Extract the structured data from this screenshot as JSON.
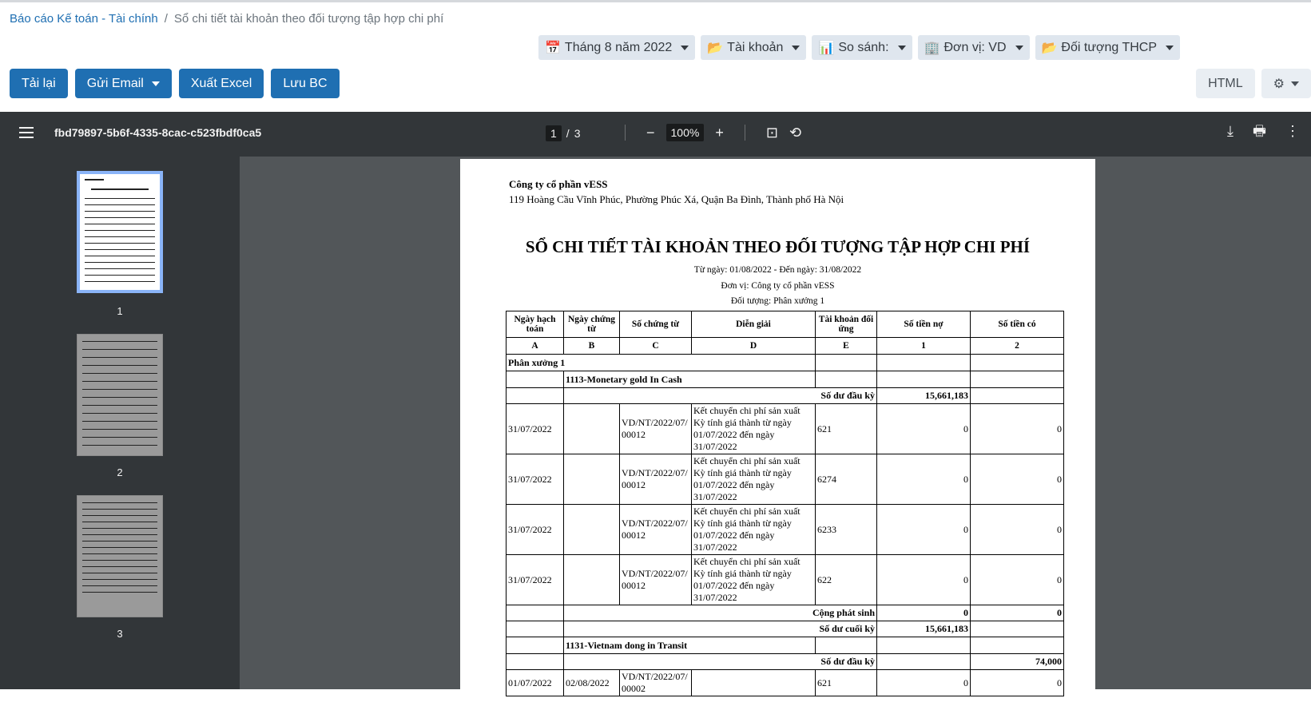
{
  "breadcrumb": {
    "root": "Báo cáo Kế toán - Tài chính",
    "separator": "/",
    "current": "Sổ chi tiết tài khoản theo đối tượng tập hợp chi phí"
  },
  "filters": {
    "period": "Tháng 8 năm 2022",
    "account": "Tài khoản",
    "compare": "So sánh:",
    "unit": "Đơn vị: VD",
    "object": "Đối tượng THCP"
  },
  "actions": {
    "reload": "Tải lại",
    "email": "Gửi Email",
    "excel": "Xuất Excel",
    "save": "Lưu BC",
    "html": "HTML"
  },
  "viewer": {
    "doc_name": "fbd79897-5b6f-4335-8cac-c523fbdf0ca5",
    "current_page": "1",
    "page_sep": "/",
    "total_pages": "3",
    "zoom": "100%",
    "thumbs": [
      "1",
      "2",
      "3"
    ]
  },
  "report": {
    "company": "Công ty cổ phần vESS",
    "address": "119 Hoàng Cầu Vĩnh Phúc, Phường Phúc Xá, Quận Ba Đình, Thành phố Hà Nội",
    "title": "SỔ CHI TIẾT TÀI KHOẢN THEO ĐỐI TƯỢNG TẬP HỢP CHI PHÍ",
    "date_range": "Từ ngày: 01/08/2022 - Đến ngày: 31/08/2022",
    "unit": "Đơn vị: Công ty cổ phần vESS",
    "object": "Đối tượng: Phân xưởng 1",
    "headers": [
      "Ngày hạch toán",
      "Ngày chứng từ",
      "Số chứng từ",
      "Diễn giải",
      "Tài khoản đối ứng",
      "Số tiền nợ",
      "Số tiền có"
    ],
    "header_codes": [
      "A",
      "B",
      "C",
      "D",
      "E",
      "1",
      "2"
    ],
    "group": "Phân xưởng 1",
    "account1": {
      "name": "1113-Monetary gold In Cash",
      "opening_label": "Số dư đầu kỳ",
      "opening_debit": "15,661,183",
      "rows": [
        {
          "post": "31/07/2022",
          "doc_date": "",
          "doc_no": "VD/NT/2022/07/00012",
          "desc": "Kết chuyển chi phí sản xuất Kỳ tính giá thành từ ngày 01/07/2022 đến ngày 31/07/2022",
          "acc": "621",
          "debit": "0",
          "credit": "0"
        },
        {
          "post": "31/07/2022",
          "doc_date": "",
          "doc_no": "VD/NT/2022/07/00012",
          "desc": "Kết chuyển chi phí sản xuất Kỳ tính giá thành từ ngày 01/07/2022 đến ngày 31/07/2022",
          "acc": "6274",
          "debit": "0",
          "credit": "0"
        },
        {
          "post": "31/07/2022",
          "doc_date": "",
          "doc_no": "VD/NT/2022/07/00012",
          "desc": "Kết chuyển chi phí sản xuất Kỳ tính giá thành từ ngày 01/07/2022 đến ngày 31/07/2022",
          "acc": "6233",
          "debit": "0",
          "credit": "0"
        },
        {
          "post": "31/07/2022",
          "doc_date": "",
          "doc_no": "VD/NT/2022/07/00012",
          "desc": "Kết chuyển chi phí sản xuất Kỳ tính giá thành từ ngày 01/07/2022 đến ngày 31/07/2022",
          "acc": "622",
          "debit": "0",
          "credit": "0"
        }
      ],
      "total_label": "Cộng phát sinh",
      "total_debit": "0",
      "total_credit": "0",
      "closing_label": "Số dư cuối kỳ",
      "closing_debit": "15,661,183"
    },
    "account2": {
      "name": "1131-Vietnam dong in Transit",
      "opening_label": "Số dư đầu kỳ",
      "opening_credit": "74,000",
      "row": {
        "post": "01/07/2022",
        "doc_date": "02/08/2022",
        "doc_no": "VD/NT/2022/07/00002",
        "acc": "621",
        "debit": "0",
        "credit": "0"
      }
    }
  }
}
